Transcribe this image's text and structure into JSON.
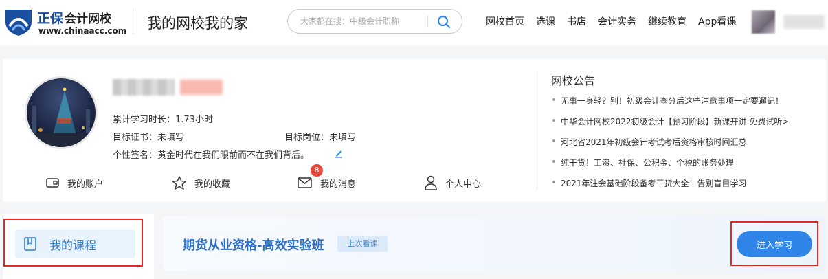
{
  "header": {
    "logo_brand": "正保",
    "logo_sub": "会计网校",
    "logo_url": "www.chinaacc.com",
    "page_title": "我的网校我的家",
    "search_placeholder": "大家都在搜：中级会计职称",
    "nav": [
      "网校首页",
      "选课",
      "书店",
      "会计实务",
      "继续教育",
      "App看课"
    ]
  },
  "profile": {
    "study_time": "累计学习时长：1.73小时",
    "target_cert": "目标证书：未填写",
    "target_post": "目标岗位：未填写",
    "signature": "个性签名：黄金时代在我们眼前而不在我们背后。",
    "quick_links": {
      "account": "我的账户",
      "favorites": "我的收藏",
      "messages": "我的消息",
      "personal": "个人中心"
    },
    "message_count": "8"
  },
  "notice": {
    "title": "网校公告",
    "items": [
      "无事一身轻？别！初级会计查分后这些注意事项一定要遛记！",
      "中华会计网校2022初级会计【预习阶段】新课开讲 免费试听>",
      "河北省2021年初级会计考试考后资格审核时间汇总",
      "纯干货！工资、社保、公积金、个税的账务处理",
      "2021年注会基础阶段备考干货大全！告别盲目学习"
    ]
  },
  "sidebar": {
    "my_course": "我的课程"
  },
  "course": {
    "title": "期货从业资格-高效实验班",
    "last_tag": "上次看课",
    "enter_button": "进入学习"
  },
  "colors": {
    "brand_blue": "#2f86e8",
    "highlight_red": "#e8271f",
    "badge_red": "#e8463a"
  }
}
